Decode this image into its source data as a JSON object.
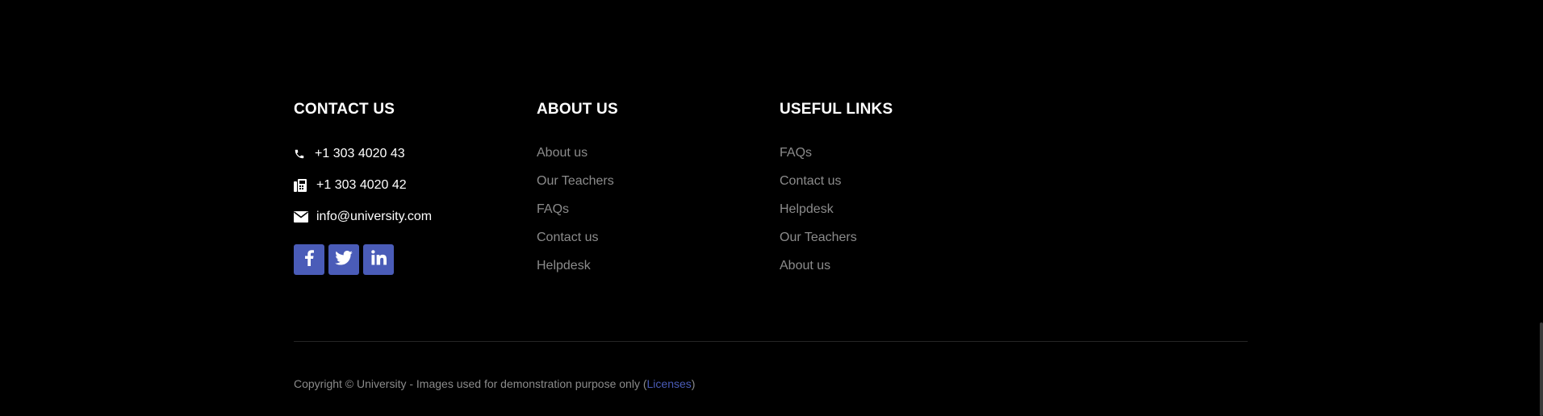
{
  "contact": {
    "title": "CONTACT US",
    "phone": "+1 303 4020 43",
    "fax": "+1 303 4020 42",
    "email": "info@university.com",
    "icons": [
      "phone-icon",
      "fax-icon",
      "envelope-icon"
    ],
    "social": [
      {
        "name": "facebook",
        "glyph": "f"
      },
      {
        "name": "twitter",
        "glyph": "twitter"
      },
      {
        "name": "linkedin",
        "glyph": "in"
      }
    ]
  },
  "about": {
    "title": "ABOUT US",
    "links": [
      "About us",
      "Our Teachers",
      "FAQs",
      "Contact us",
      "Helpdesk"
    ]
  },
  "useful": {
    "title": "USEFUL LINKS",
    "links": [
      "FAQs",
      "Contact us",
      "Helpdesk",
      "Our Teachers",
      "About us"
    ]
  },
  "copyright": {
    "text": "Copyright © University - Images used for demonstration purpose only (",
    "link": "Licenses",
    "close": ")"
  },
  "colors": {
    "background": "#000000",
    "accent": "#4a5cb8",
    "link": "#8b8b8b",
    "heading": "#ffffff"
  }
}
